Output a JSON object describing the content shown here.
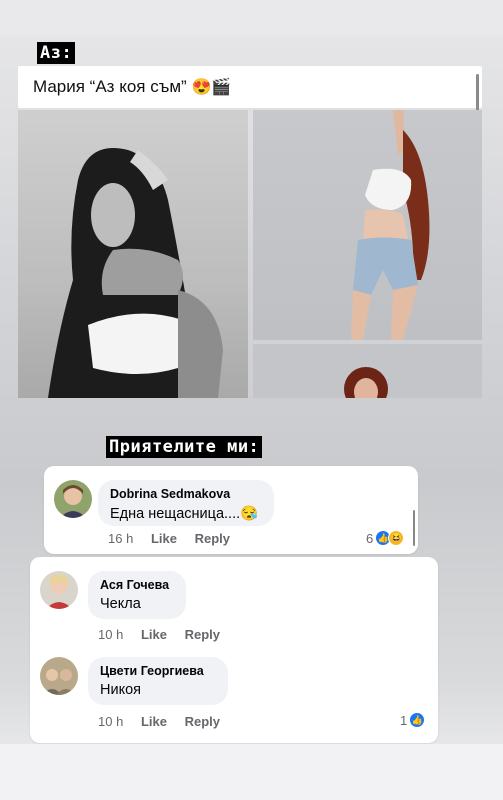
{
  "story": {
    "tag_me": "Аз:",
    "tag_friends": "Приятелите ми:"
  },
  "post": {
    "caption": "Мария “Аз коя съм”",
    "caption_emoji": "😍🎬"
  },
  "comments": [
    {
      "author": "Dobrina Sedmakova",
      "text": "Една нещасница....",
      "text_emoji": "😪",
      "time": "16 h",
      "like_label": "Like",
      "reply_label": "Reply",
      "reaction_count": "6",
      "reactions": [
        "like-icon",
        "haha-icon"
      ]
    },
    {
      "author": "Ася Гочева",
      "text": "Чекла",
      "time": "10 h",
      "like_label": "Like",
      "reply_label": "Reply"
    },
    {
      "author": "Цвети Георгиева",
      "text": "Никоя",
      "time": "10 h",
      "like_label": "Like",
      "reply_label": "Reply",
      "reaction_count": "1",
      "reactions": [
        "like-icon"
      ]
    }
  ],
  "colors": {
    "like_blue": "#1877f2",
    "meta_gray": "#65676b",
    "bubble_bg": "#f0f2f5"
  }
}
